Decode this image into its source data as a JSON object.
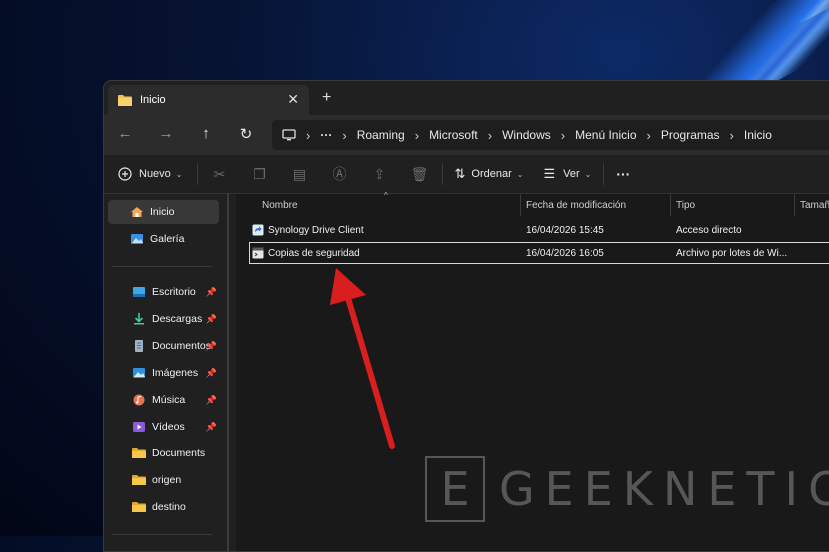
{
  "tab": {
    "title": "Inicio",
    "close": "✕",
    "new_tab": "+"
  },
  "breadcrumb": [
    "Roaming",
    "Microsoft",
    "Windows",
    "Menú Inicio",
    "Programas",
    "Inicio"
  ],
  "breadcrumb_overflow": "···",
  "toolbar": {
    "new_label": "Nuevo",
    "sort_label": "Ordenar",
    "view_label": "Ver",
    "more": "···"
  },
  "sidebar": {
    "items": [
      {
        "label": "Inicio",
        "icon": "home-icon"
      },
      {
        "label": "Galería",
        "icon": "gallery-icon"
      }
    ],
    "pinned": [
      {
        "label": "Escritorio",
        "icon": "desktop-icon"
      },
      {
        "label": "Descargas",
        "icon": "download-icon"
      },
      {
        "label": "Documentos",
        "icon": "documents-icon"
      },
      {
        "label": "Imágenes",
        "icon": "pictures-icon"
      },
      {
        "label": "Música",
        "icon": "music-icon"
      },
      {
        "label": "Vídeos",
        "icon": "videos-icon"
      }
    ],
    "folders": [
      {
        "label": "Documents"
      },
      {
        "label": "origen"
      },
      {
        "label": "destino"
      }
    ]
  },
  "columns": {
    "name": "Nombre",
    "modified": "Fecha de modificación",
    "type": "Tipo",
    "size": "Tamaño"
  },
  "files": [
    {
      "name": "Synology Drive Client",
      "modified": "16/04/2026 15:45",
      "type": "Acceso directo",
      "icon": "shortcut-icon"
    },
    {
      "name": "Copias de seguridad",
      "modified": "16/04/2026 16:05",
      "type": "Archivo por lotes de Wi...",
      "icon": "batch-file-icon"
    }
  ],
  "watermark": {
    "box_letter": "E",
    "text": "GEEKNETIC"
  },
  "colors": {
    "accent": "#2a7bff",
    "arrow": "#d81e1e",
    "folder": "#f2c14e",
    "window_bg": "#202020"
  }
}
